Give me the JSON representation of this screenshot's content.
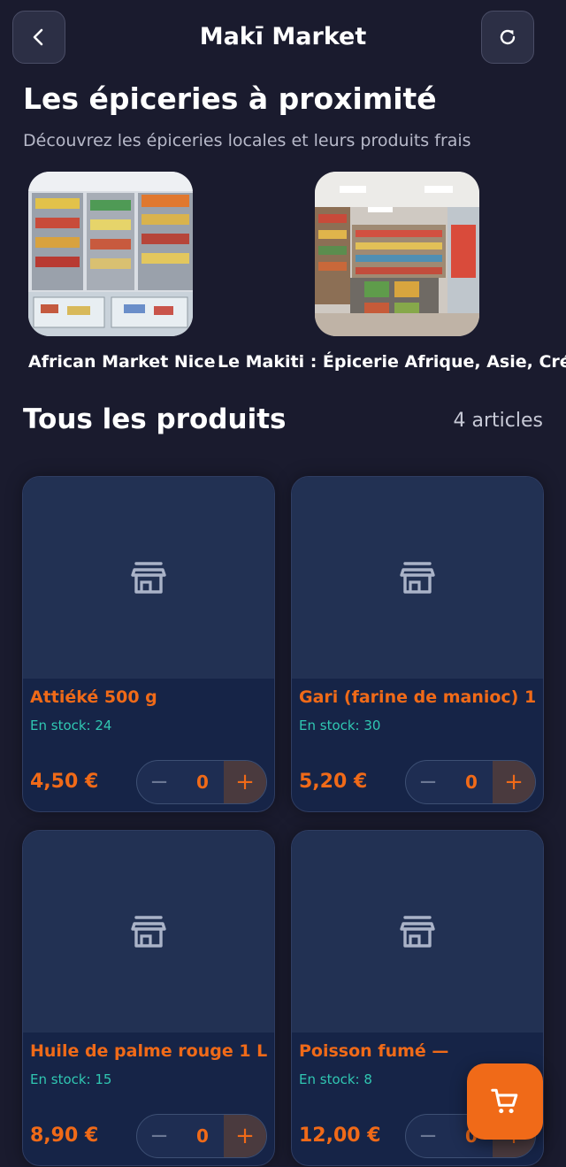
{
  "header": {
    "title": "Makī Market",
    "back_icon": "chevron-left-icon",
    "refresh_icon": "refresh-icon"
  },
  "nearby": {
    "title": "Les épiceries à proximité",
    "subtitle": "Découvrez les épiceries locales et leurs produits frais",
    "stores": [
      {
        "name": "African Market Nice"
      },
      {
        "name": "Le Makiti : Épicerie Afrique, Asie, Créole"
      }
    ]
  },
  "products": {
    "title": "Tous les produits",
    "count": "4 articles",
    "items": [
      {
        "name": "Attiéké 500 g",
        "stock": "En stock: 24",
        "price": "4,50 €",
        "qty": "0"
      },
      {
        "name": "Gari (farine de manioc) 1",
        "stock": "En stock: 30",
        "price": "5,20 €",
        "qty": "0"
      },
      {
        "name": "Huile de palme rouge 1 L",
        "stock": "En stock: 15",
        "price": "8,90 €",
        "qty": "0"
      },
      {
        "name": "Poisson fumé —",
        "stock": "En stock: 8",
        "price": "12,00 €",
        "qty": "0"
      }
    ],
    "minus_label": "−",
    "plus_label": "+",
    "placeholder_icon": "store-icon"
  },
  "cart": {
    "icon": "cart-icon"
  },
  "colors": {
    "background": "#1a1b2e",
    "accent": "#f06a18",
    "stock": "#30c7b2",
    "card": "#162447"
  }
}
